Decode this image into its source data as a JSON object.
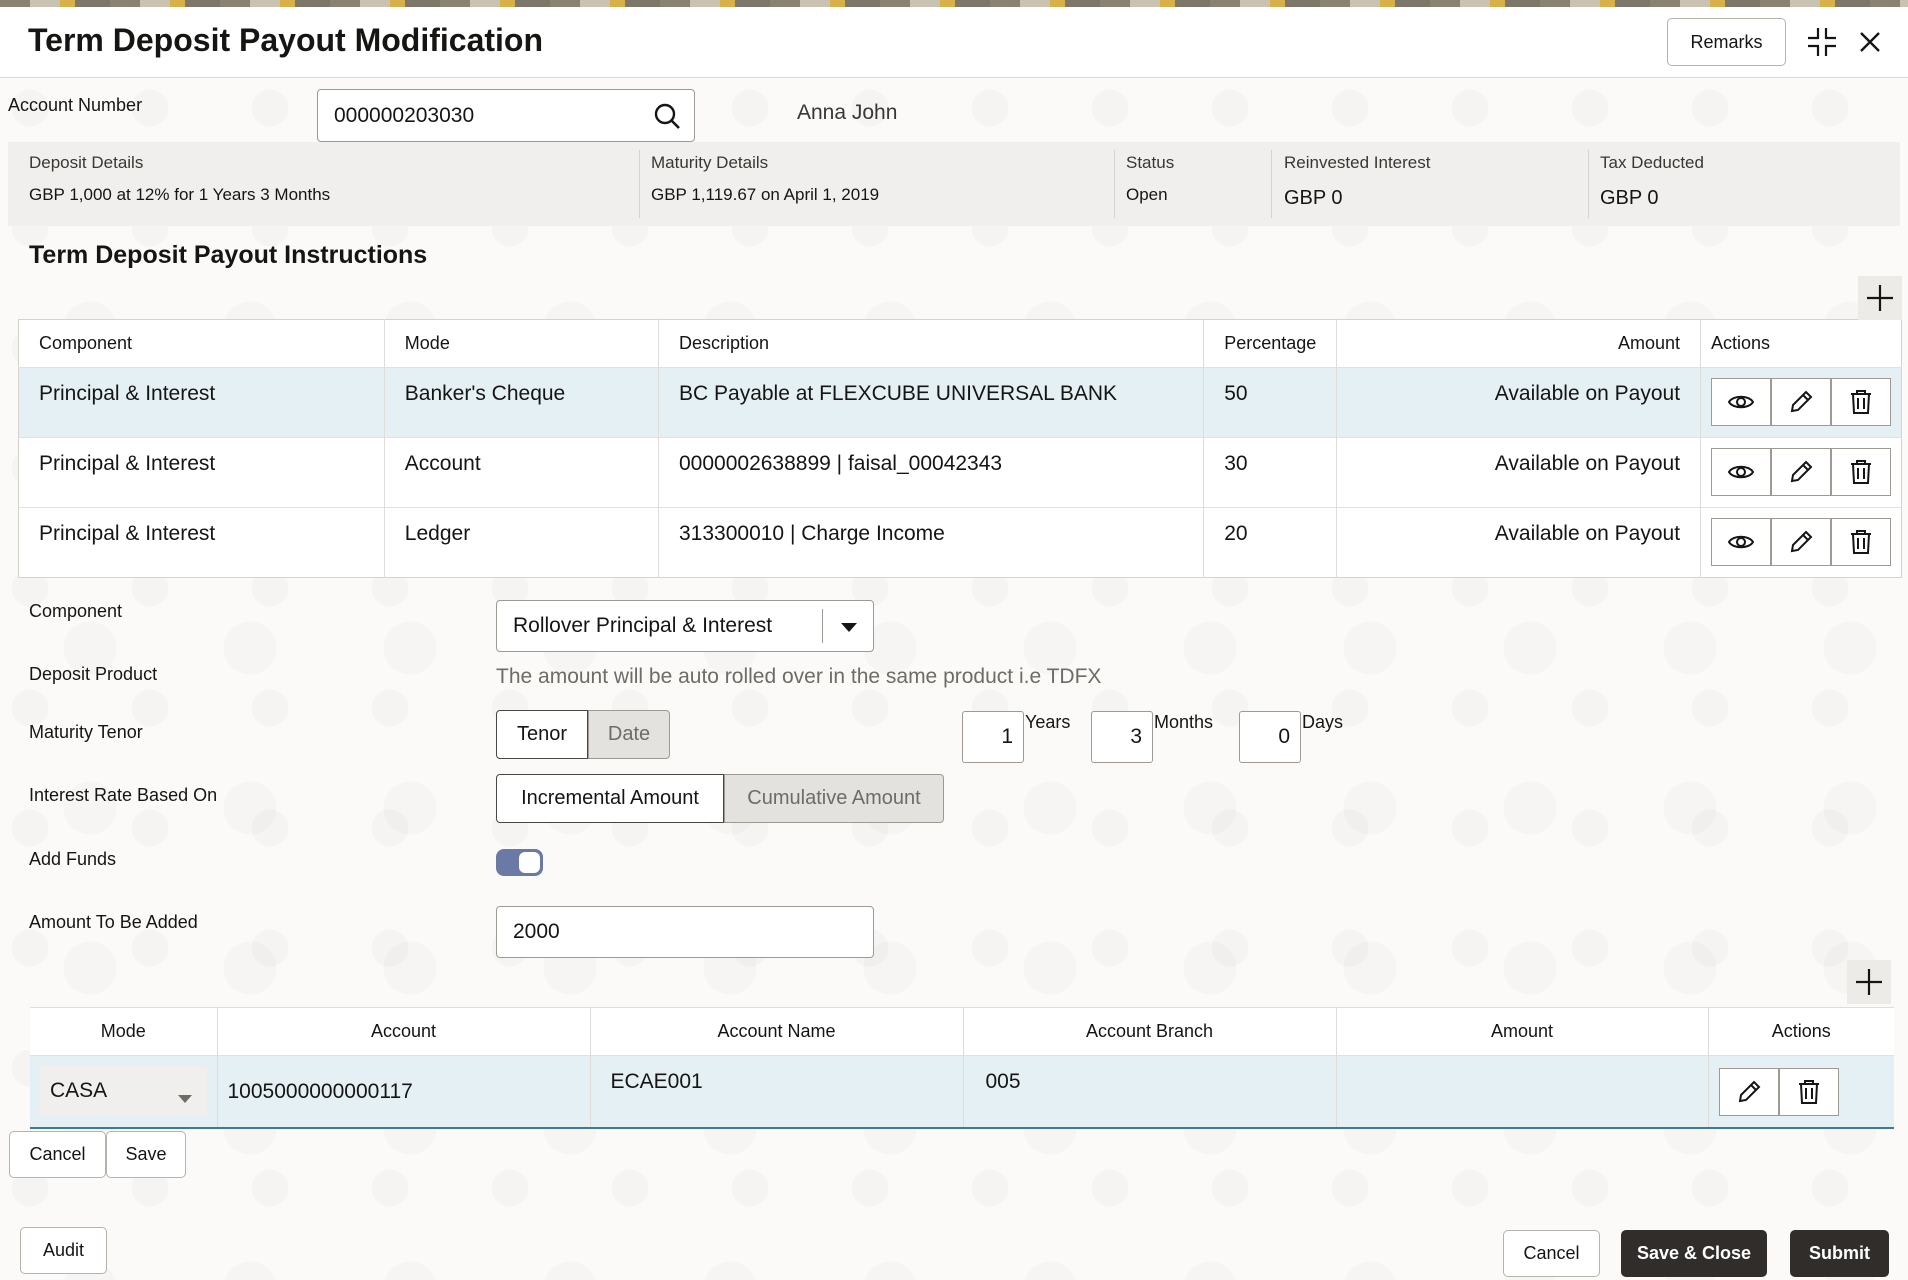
{
  "header": {
    "title": "Term Deposit Payout Modification",
    "remarks_label": "Remarks"
  },
  "account": {
    "label": "Account Number",
    "value": "000000203030",
    "customer_name": "Anna John"
  },
  "summary": {
    "deposit_details_label": "Deposit Details",
    "deposit_details_value": "GBP 1,000 at 12% for 1 Years 3 Months",
    "maturity_details_label": "Maturity Details",
    "maturity_details_value": "GBP 1,119.67 on April 1, 2019",
    "status_label": "Status",
    "status_value": "Open",
    "reinvested_interest_label": "Reinvested Interest",
    "reinvested_interest_value": "GBP 0",
    "tax_deducted_label": "Tax Deducted",
    "tax_deducted_value": "GBP 0"
  },
  "instructions": {
    "title": "Term Deposit Payout Instructions",
    "columns": [
      "Component",
      "Mode",
      "Description",
      "Percentage",
      "Amount",
      "Actions"
    ],
    "rows": [
      {
        "component": "Principal & Interest",
        "mode": "Banker's Cheque",
        "description": "BC Payable at FLEXCUBE UNIVERSAL BANK",
        "percentage": "50",
        "amount": "Available on Payout"
      },
      {
        "component": "Principal & Interest",
        "mode": "Account",
        "description": "0000002638899 | faisal_00042343",
        "percentage": "30",
        "amount": "Available on Payout"
      },
      {
        "component": "Principal & Interest",
        "mode": "Ledger",
        "description": "313300010 | Charge Income",
        "percentage": "20",
        "amount": "Available on Payout"
      }
    ]
  },
  "form": {
    "component_label": "Component",
    "component_value": "Rollover Principal & Interest",
    "deposit_product_label": "Deposit Product",
    "deposit_product_text": "The amount will be auto rolled over in the same product i.e TDFX",
    "maturity_tenor_label": "Maturity Tenor",
    "tenor_option": "Tenor",
    "date_option": "Date",
    "years_value": "1",
    "years_unit": "Years",
    "months_value": "3",
    "months_unit": "Months",
    "days_value": "0",
    "days_unit": "Days",
    "interest_rate_label": "Interest Rate Based On",
    "incremental_option": "Incremental Amount",
    "cumulative_option": "Cumulative Amount",
    "add_funds_label": "Add Funds",
    "add_funds_on": true,
    "amount_to_add_label": "Amount To Be Added",
    "amount_to_add_value": "2000"
  },
  "funds": {
    "columns": [
      "Mode",
      "Account",
      "Account Name",
      "Account Branch",
      "Amount",
      "Actions"
    ],
    "row": {
      "mode": "CASA",
      "account": "1005000000000117",
      "account_name": "ECAE001",
      "account_branch": "005",
      "amount": ""
    },
    "cancel_label": "Cancel",
    "save_label": "Save"
  },
  "footer": {
    "audit_label": "Audit",
    "cancel_label": "Cancel",
    "save_close_label": "Save & Close",
    "submit_label": "Submit"
  },
  "colors": {
    "selected_row": "#e4f0f4",
    "toggle_on": "#6b7aa5",
    "primary_button": "#302d2b"
  }
}
